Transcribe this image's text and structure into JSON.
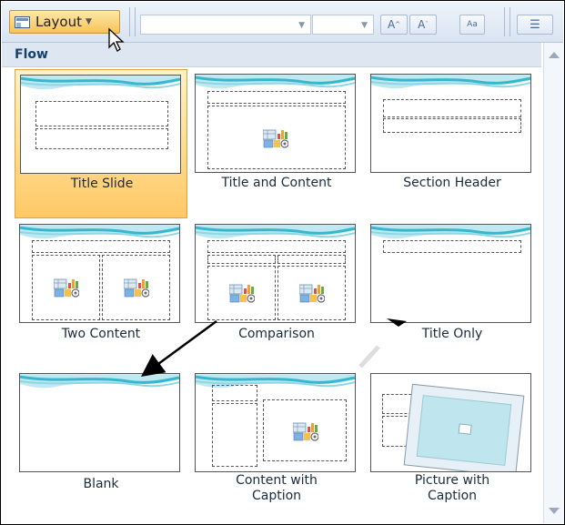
{
  "toolbar": {
    "layout_button": {
      "label": "Layout",
      "icon": "layout-icon"
    }
  },
  "gallery": {
    "section_title": "Flow",
    "layouts": [
      {
        "label": "Title Slide",
        "selected": true
      },
      {
        "label": "Title and Content",
        "selected": false
      },
      {
        "label": "Section Header",
        "selected": false
      },
      {
        "label": "Two Content",
        "selected": false
      },
      {
        "label": "Comparison",
        "selected": false
      },
      {
        "label": "Title Only",
        "selected": false
      },
      {
        "label": "Blank",
        "selected": false
      },
      {
        "label": "Content with Caption",
        "selected": false
      },
      {
        "label": "Picture with Caption",
        "selected": false
      }
    ]
  },
  "colors": {
    "selected_tile": "#ffd98a",
    "section_header": "#dde6f1",
    "wave": "#4fc4d8"
  }
}
